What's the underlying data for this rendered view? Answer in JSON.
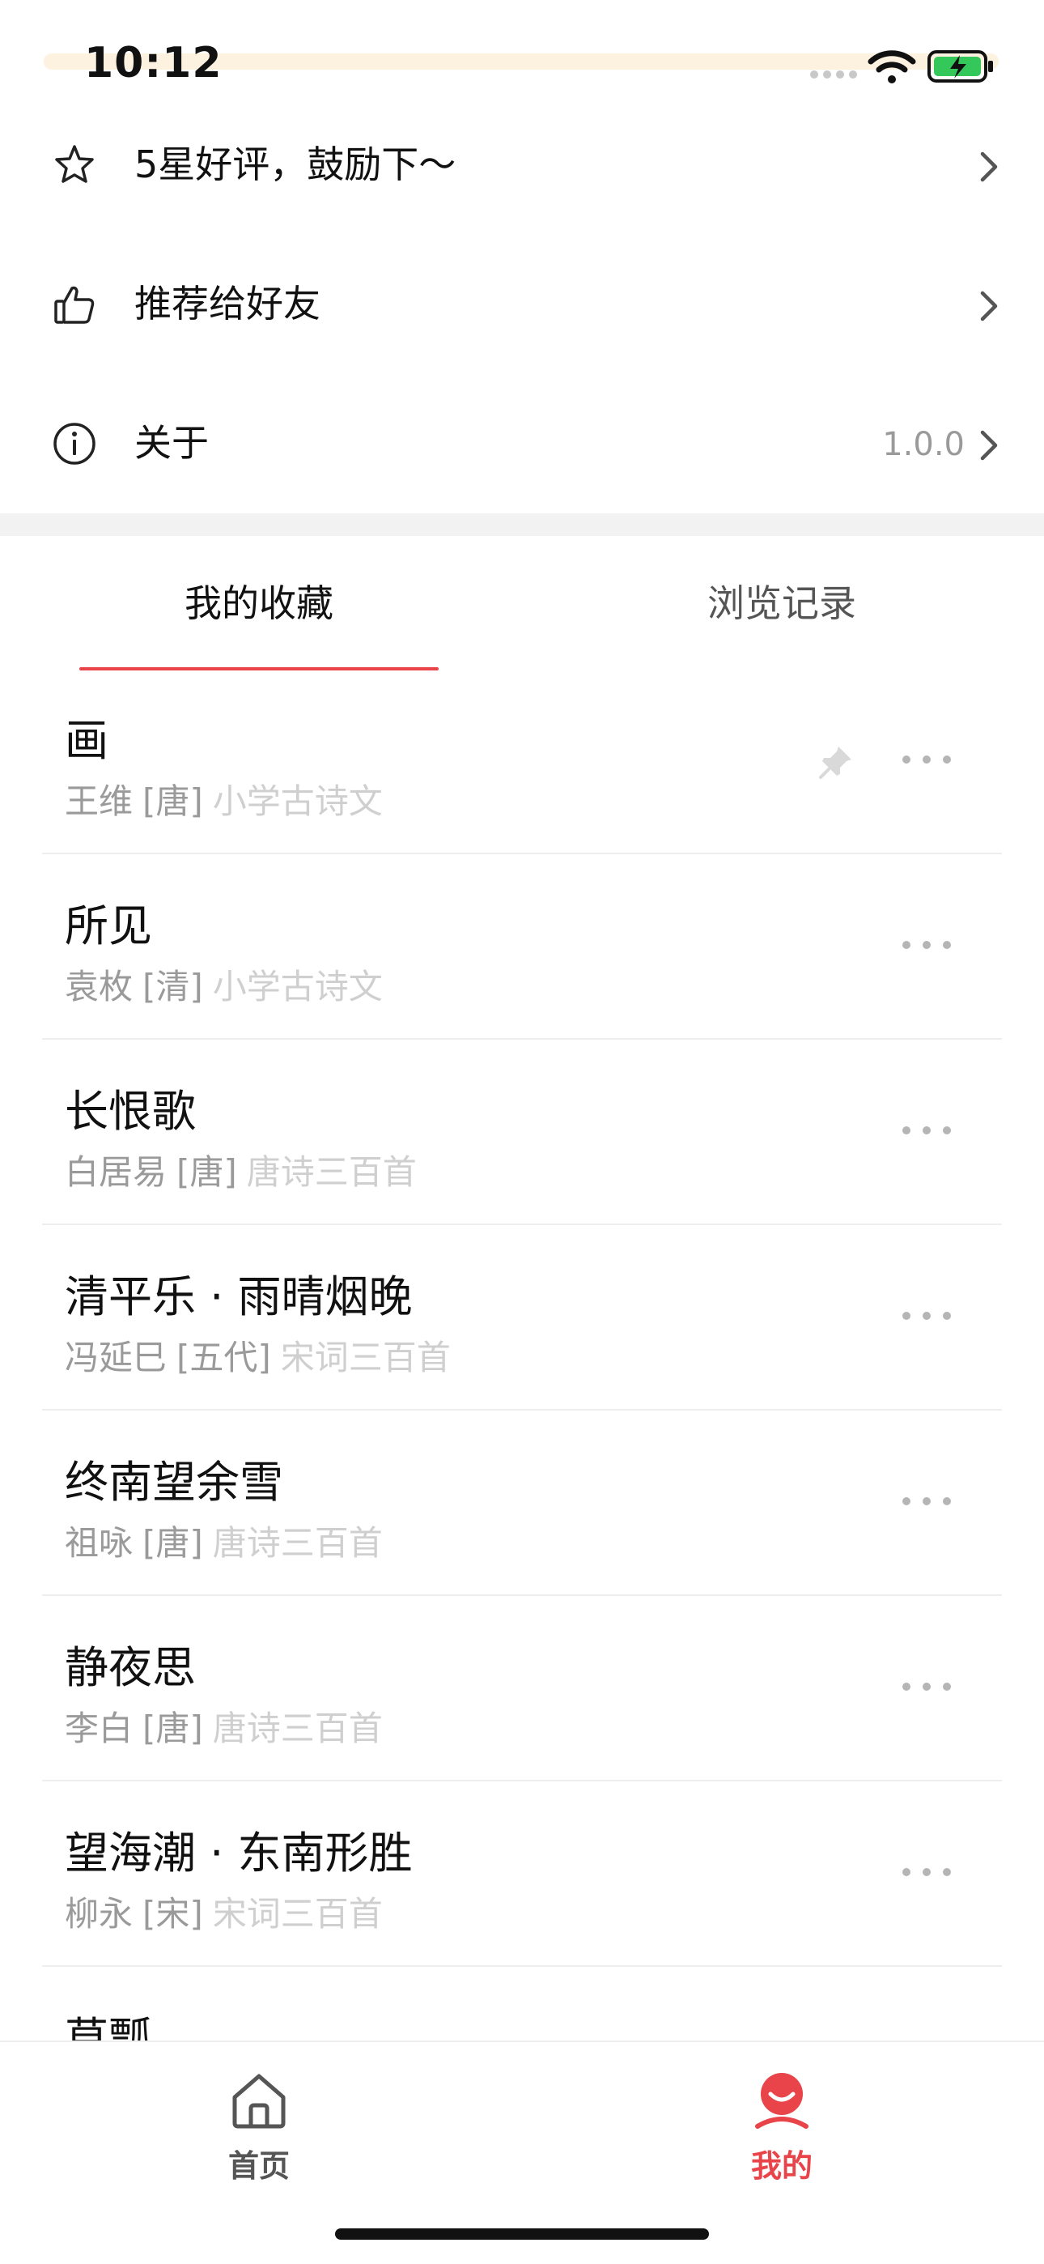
{
  "status_bar": {
    "time": "10:12"
  },
  "settings": [
    {
      "icon": "star-icon",
      "label": "5星好评，鼓励下～",
      "value": ""
    },
    {
      "icon": "thumbs-up-icon",
      "label": "推荐给好友",
      "value": ""
    },
    {
      "icon": "info-icon",
      "label": "关于",
      "value": "1.0.0"
    }
  ],
  "tabs": [
    {
      "label": "我的收藏",
      "active": true
    },
    {
      "label": "浏览记录",
      "active": false
    }
  ],
  "poems": [
    {
      "title": "画",
      "author": "王维",
      "dynasty": "[唐]",
      "collection": "小学古诗文",
      "pinned": true
    },
    {
      "title": "所见",
      "author": "袁枚",
      "dynasty": "[清]",
      "collection": "小学古诗文",
      "pinned": false
    },
    {
      "title": "长恨歌",
      "author": "白居易",
      "dynasty": "[唐]",
      "collection": "唐诗三百首",
      "pinned": false
    },
    {
      "title": "清平乐 · 雨晴烟晚",
      "author": "冯延巳",
      "dynasty": "[五代]",
      "collection": "宋词三百首",
      "pinned": false
    },
    {
      "title": "终南望余雪",
      "author": "祖咏",
      "dynasty": "[唐]",
      "collection": "唐诗三百首",
      "pinned": false
    },
    {
      "title": "静夜思",
      "author": "李白",
      "dynasty": "[唐]",
      "collection": "唐诗三百首",
      "pinned": false
    },
    {
      "title": "望海潮 · 东南形胜",
      "author": "柳永",
      "dynasty": "[宋]",
      "collection": "宋词三百首",
      "pinned": false
    },
    {
      "title": "草瓢",
      "author": "",
      "dynasty": "",
      "collection": "",
      "pinned": false
    }
  ],
  "tab_bar": {
    "items": [
      {
        "label": "首页",
        "icon": "home-icon",
        "active": false
      },
      {
        "label": "我的",
        "icon": "smile-face-icon",
        "active": true
      }
    ]
  },
  "colors": {
    "accent": "#e8444a",
    "muted": "#9a9a9a",
    "faint": "#cfcfcf",
    "divider": "#f2f2f2"
  }
}
